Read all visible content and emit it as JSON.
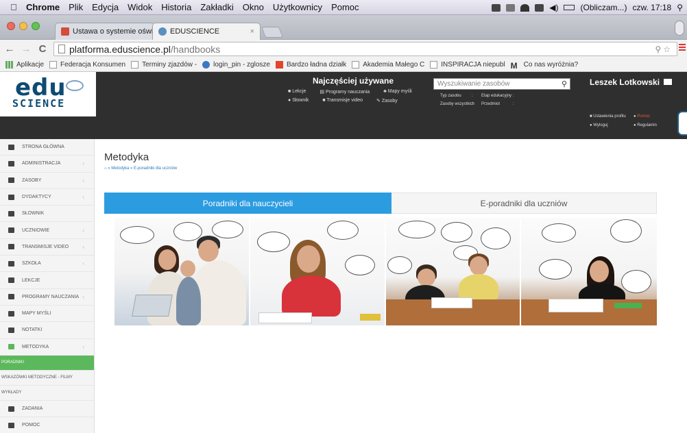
{
  "os_menu": {
    "app": "Chrome",
    "items": [
      "Plik",
      "Edycja",
      "Widok",
      "Historia",
      "Zakładki",
      "Okno",
      "Użytkownicy",
      "Pomoc"
    ],
    "status": "(Obliczam...)",
    "clock": "czw. 17:18"
  },
  "browser": {
    "tabs": [
      {
        "title": "Ustawa o systemie oświat",
        "favicon_color": "#d64b3a"
      },
      {
        "title": "EDUSCIENCE",
        "favicon_color": "#5a8fc0"
      }
    ],
    "url_host": "platforma.eduscience.pl",
    "url_path": "/handbooks",
    "bookmarks": [
      {
        "label": "Aplikacje",
        "icon": "apps-icon"
      },
      {
        "label": "Federacja Konsumen",
        "icon": "page-icon"
      },
      {
        "label": "Terminy zjazdów -",
        "icon": "page-icon"
      },
      {
        "label": "login_pin - zglosze",
        "icon": "globe-icon"
      },
      {
        "label": "Bardzo ładna działk",
        "icon": "red-icon"
      },
      {
        "label": "Akademia Małego C",
        "icon": "page-icon"
      },
      {
        "label": "INSPIRACJA niepubl",
        "icon": "page-icon"
      },
      {
        "label": "Co nas wyróżnia?",
        "icon": "m-icon"
      }
    ]
  },
  "header": {
    "logo_top": "edu",
    "logo_bottom": "SCIENCE",
    "popular_title": "Najczęściej używane",
    "popular_row1": [
      "Lekcje",
      "Programy nauczania",
      "Mapy myśli"
    ],
    "popular_row2": [
      "Słownik",
      "Transmisje video",
      "Zasoby"
    ],
    "search_placeholder": "Wyszukiwanie zasobów",
    "filter_row1": [
      "Typ zasobu",
      ":",
      "Etap edukacyjny",
      ":"
    ],
    "filter_row2": [
      "Zasoby wszystkich",
      ":",
      "Przedmiot",
      ":"
    ],
    "user": "Leszek Lotkowski",
    "profile_settings": "Ustawienia profilu",
    "help": "Pomoc",
    "logout": "Wyloguj",
    "rules": "Regulamin"
  },
  "sidebar": {
    "items": [
      {
        "label": "STRONA GŁÓWNA",
        "arrow": false
      },
      {
        "label": "ADMINISTRACJA",
        "arrow": true
      },
      {
        "label": "ZASOBY",
        "arrow": true
      },
      {
        "label": "DYDAKTYCY",
        "arrow": true
      },
      {
        "label": "SŁOWNIK",
        "arrow": false
      },
      {
        "label": "UCZNIOWIE",
        "arrow": true
      },
      {
        "label": "TRANSMISJE VIDEO",
        "arrow": true
      },
      {
        "label": "SZKOŁA",
        "arrow": true
      },
      {
        "label": "LEKCJE",
        "arrow": false
      },
      {
        "label": "PROGRAMY NAUCZANIA",
        "arrow": true
      },
      {
        "label": "MAPY MYŚLI",
        "arrow": false
      },
      {
        "label": "NOTATKI",
        "arrow": false
      },
      {
        "label": "METODYKA",
        "arrow": true
      }
    ],
    "sub_items": [
      "PORADNIKI",
      "WSKAZÓWKI METODYCZNE - FILMY",
      "WYKŁADY"
    ],
    "tail_items": [
      "ZADANIA",
      "POMOC"
    ]
  },
  "main": {
    "title": "Metodyka",
    "breadcrumb": "⌂ » Metodyka » E-poradniki dla uczniów",
    "tab_teachers": "Poradniki dla nauczycieli",
    "tab_students": "E-poradniki dla uczniów"
  },
  "colors": {
    "accent_blue": "#2c9ce0",
    "active_green": "#5cb85c",
    "header_dark": "#2f2f2f",
    "logo_blue": "#0d4b73"
  }
}
